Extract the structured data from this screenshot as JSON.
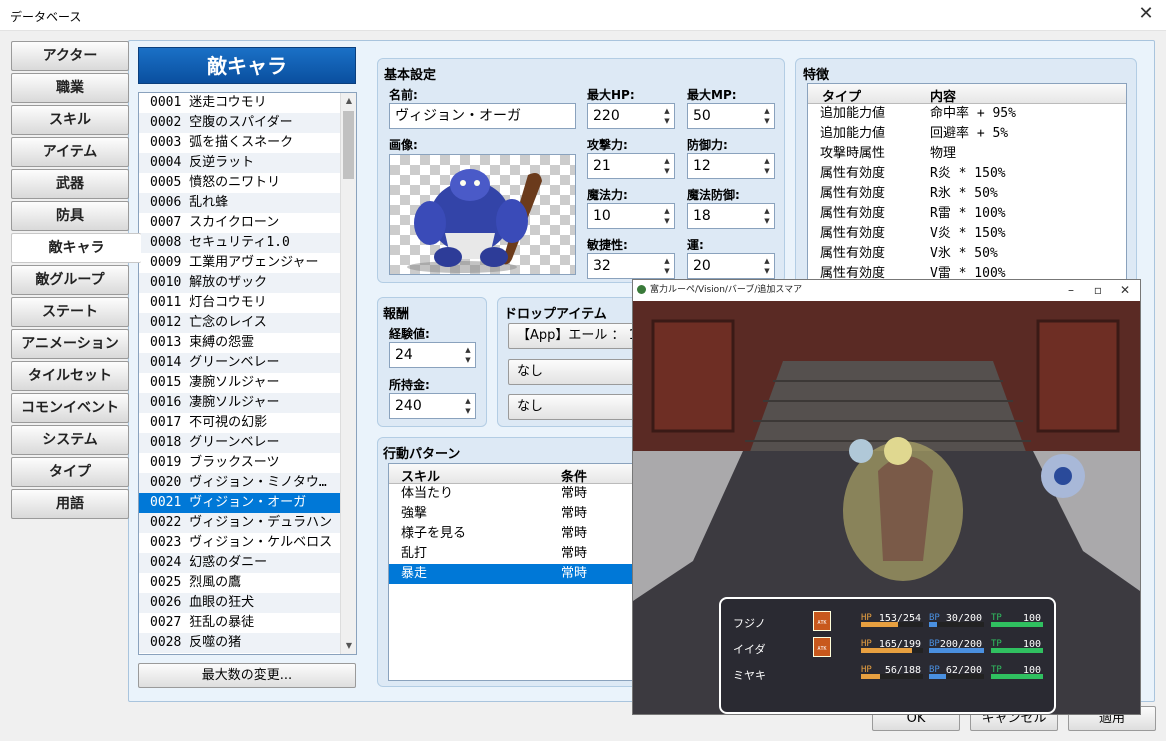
{
  "window": {
    "title": "データベース",
    "close": "✕"
  },
  "tabs": [
    "アクター",
    "職業",
    "スキル",
    "アイテム",
    "武器",
    "防具",
    "敵キャラ",
    "敵グループ",
    "ステート",
    "アニメーション",
    "タイルセット",
    "コモンイベント",
    "システム",
    "タイプ",
    "用語"
  ],
  "active_tab": "敵キャラ",
  "list": {
    "header": "敵キャラ",
    "items": [
      "0001 迷走コウモリ",
      "0002 空腹のスパイダー",
      "0003 弧を描くスネーク",
      "0004 反逆ラット",
      "0005 憤怒のニワトリ",
      "0006 乱れ蜂",
      "0007 スカイクローン",
      "0008 セキュリティ1.0",
      "0009 工業用アヴェンジャー",
      "0010 解放のザック",
      "0011 灯台コウモリ",
      "0012 亡念のレイス",
      "0013 束縛の怨霊",
      "0014 グリーンベレー",
      "0015 凄腕ソルジャー",
      "0016 凄腕ソルジャー",
      "0017 不可視の幻影",
      "0018 グリーンベレー",
      "0019 ブラックスーツ",
      "0020 ヴィジョン・ミノタウ…",
      "0021 ヴィジョン・オーガ",
      "0022 ヴィジョン・デュラハン",
      "0023 ヴィジョン・ケルベロス",
      "0024 幻惑のダニー",
      "0025 烈風の鷹",
      "0026 血眼の狂犬",
      "0027 狂乱の暴徒",
      "0028 反噬の猪"
    ],
    "selected_index": 20,
    "max_button": "最大数の変更..."
  },
  "basic": {
    "heading": "基本設定",
    "name_label": "名前:",
    "name_value": "ヴィジョン・オーガ",
    "image_label": "画像:",
    "stats": [
      {
        "label": "最大HP:",
        "value": "220"
      },
      {
        "label": "最大MP:",
        "value": "50"
      },
      {
        "label": "攻撃力:",
        "value": "21"
      },
      {
        "label": "防御力:",
        "value": "12"
      },
      {
        "label": "魔法力:",
        "value": "10"
      },
      {
        "label": "魔法防御:",
        "value": "18"
      },
      {
        "label": "敏捷性:",
        "value": "32"
      },
      {
        "label": "運:",
        "value": "20"
      }
    ]
  },
  "reward": {
    "heading": "報酬",
    "exp_label": "経験値:",
    "exp_value": "24",
    "gold_label": "所持金:",
    "gold_value": "240"
  },
  "drop": {
    "heading": "ドロップアイテム",
    "items": [
      "【App】エール ： 1",
      "なし",
      "なし"
    ]
  },
  "actions": {
    "heading": "行動パターン",
    "col_skill": "スキル",
    "col_cond": "条件",
    "rows": [
      {
        "skill": "体当たり",
        "cond": "常時"
      },
      {
        "skill": "強撃",
        "cond": "常時"
      },
      {
        "skill": "様子を見る",
        "cond": "常時"
      },
      {
        "skill": "乱打",
        "cond": "常時"
      },
      {
        "skill": "暴走",
        "cond": "常時"
      }
    ],
    "selected_index": 4
  },
  "traits": {
    "heading": "特徴",
    "col_type": "タイプ",
    "col_content": "内容",
    "rows": [
      {
        "type": "追加能力値",
        "content": "命中率 + 95%"
      },
      {
        "type": "追加能力値",
        "content": "回避率 + 5%"
      },
      {
        "type": "攻撃時属性",
        "content": "物理"
      },
      {
        "type": "属性有効度",
        "content": "R炎 * 150%"
      },
      {
        "type": "属性有効度",
        "content": "R氷 * 50%"
      },
      {
        "type": "属性有効度",
        "content": "R雷 * 100%"
      },
      {
        "type": "属性有効度",
        "content": "V炎 * 150%"
      },
      {
        "type": "属性有効度",
        "content": "V氷 * 50%"
      },
      {
        "type": "属性有効度",
        "content": "V雷 * 100%"
      }
    ]
  },
  "buttons": {
    "ok": "OK",
    "cancel": "キャンセル",
    "apply": "適用"
  },
  "game": {
    "title": "富力ルーペ/Vision/バーブ/追加スマア",
    "party": [
      {
        "name": "フジノ",
        "atk": "ATK",
        "hp": "153/254",
        "hp_frac": 0.6,
        "mp": "30/200",
        "mp_frac": 0.15,
        "tp": "100",
        "tp_frac": 1.0
      },
      {
        "name": "イイダ",
        "atk": "ATK",
        "hp": "165/199",
        "hp_frac": 0.83,
        "mp": "200/200",
        "mp_frac": 1.0,
        "tp": "100",
        "tp_frac": 1.0
      },
      {
        "name": "ミヤキ",
        "atk": "",
        "hp": "56/188",
        "hp_frac": 0.3,
        "mp": "62/200",
        "mp_frac": 0.31,
        "tp": "100",
        "tp_frac": 1.0
      }
    ],
    "labels": {
      "hp": "HP",
      "mp": "BP",
      "tp": "TP"
    }
  },
  "colors": {
    "accent": "#0078d7",
    "header": "#0a5cb3",
    "hp": "#e8a040",
    "mp": "#4a90e0",
    "tp": "#30c060"
  }
}
